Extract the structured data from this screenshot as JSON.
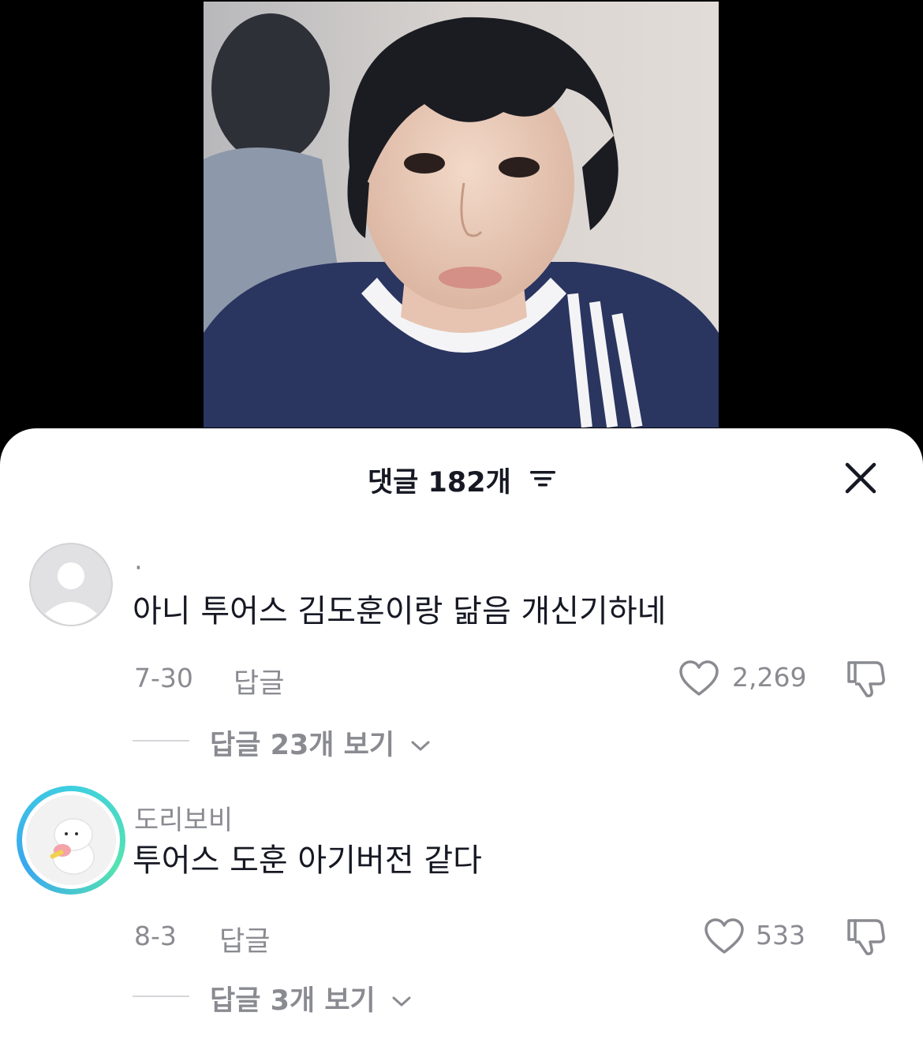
{
  "video": {
    "thumbnail_icon": "video-frame-person"
  },
  "header": {
    "title": "댓글 182개",
    "sort_icon": "sort-lines-icon",
    "close_icon": "close-x-icon"
  },
  "comments": [
    {
      "username": "·",
      "text": "아니 투어스 김도훈이랑 닮음 개신기하네",
      "date": "7-30",
      "reply_label": "답글",
      "likes": "2,269",
      "view_replies": "답글 23개 보기"
    },
    {
      "username": "도리보비",
      "text": "투어스 도훈 아기버전 같다",
      "date": "8-3",
      "reply_label": "답글",
      "likes": "533",
      "view_replies": "답글 3개 보기"
    }
  ],
  "colors": {
    "background": "#000000",
    "sheet": "#ffffff",
    "text_primary": "#161823",
    "text_secondary": "#8a8b91",
    "story_ring": "#3ecfe0"
  }
}
